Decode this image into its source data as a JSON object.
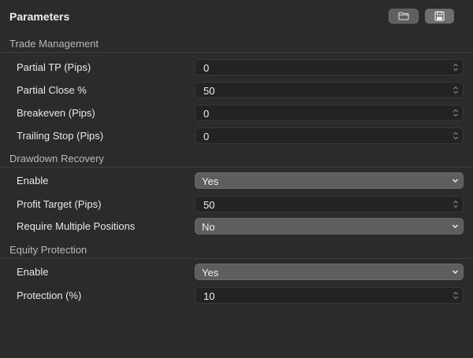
{
  "header": {
    "title": "Parameters",
    "open_icon": "folder-icon",
    "save_icon": "floppy-disk-icon"
  },
  "sections": [
    {
      "label": "Trade Management",
      "rows": [
        {
          "label": "Partial TP (Pips)",
          "value": "0",
          "kind": "number"
        },
        {
          "label": "Partial Close %",
          "value": "50",
          "kind": "number"
        },
        {
          "label": "Breakeven (Pips)",
          "value": "0",
          "kind": "number"
        },
        {
          "label": "Trailing Stop (Pips)",
          "value": "0",
          "kind": "number"
        }
      ]
    },
    {
      "label": "Drawdown Recovery",
      "rows": [
        {
          "label": "Enable",
          "value": "Yes",
          "kind": "select"
        },
        {
          "label": "Profit Target (Pips)",
          "value": "50",
          "kind": "number"
        },
        {
          "label": "Require Multiple Positions",
          "value": "No",
          "kind": "select"
        }
      ]
    },
    {
      "label": "Equity Protection",
      "rows": [
        {
          "label": "Enable",
          "value": "Yes",
          "kind": "select"
        },
        {
          "label": "Protection (%)",
          "value": "10",
          "kind": "number"
        }
      ]
    }
  ],
  "colors": {
    "background": "#2b2b2b",
    "input_bg": "#232323",
    "select_bg": "#5e5e5e",
    "text": "#e8e8e8",
    "section_text": "#b8b8b8"
  }
}
